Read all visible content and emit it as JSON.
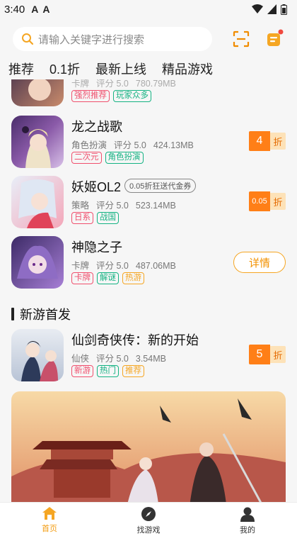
{
  "status_bar": {
    "time": "3:40"
  },
  "search": {
    "placeholder": "请输入关键字进行搜索"
  },
  "tabs": [
    "推荐",
    "0.1折",
    "最新上线",
    "精品游戏"
  ],
  "partial_game": {
    "meta": [
      "卡牌",
      "评分 5.0",
      "780.79MB"
    ],
    "tags": [
      {
        "text": "强烈推荐",
        "color": "red"
      },
      {
        "text": "玩家众多",
        "color": "green"
      }
    ]
  },
  "games": [
    {
      "name": "龙之战歌",
      "category": "角色扮演",
      "rating": "评分 5.0",
      "size": "424.13MB",
      "tags": [
        {
          "text": "二次元",
          "color": "red"
        },
        {
          "text": "角色扮演",
          "color": "green"
        }
      ],
      "discount": "4",
      "discount_unit": "折"
    },
    {
      "name": "妖姬OL2",
      "badge": "0.05折狂送代金券",
      "category": "策略",
      "rating": "评分 5.0",
      "size": "523.14MB",
      "tags": [
        {
          "text": "日系",
          "color": "red"
        },
        {
          "text": "战国",
          "color": "green"
        }
      ],
      "discount": "0.05",
      "discount_unit": "折"
    },
    {
      "name": "神隐之子",
      "category": "卡牌",
      "rating": "评分 5.0",
      "size": "487.06MB",
      "tags": [
        {
          "text": "卡牌",
          "color": "red"
        },
        {
          "text": "解谜",
          "color": "green"
        },
        {
          "text": "热游",
          "color": "orange"
        }
      ],
      "action": "详情"
    }
  ],
  "section": {
    "title": "新游首发"
  },
  "new_game": {
    "name": "仙剑奇侠传：新的开始",
    "category": "仙侠",
    "rating": "评分 5.0",
    "size": "3.54MB",
    "tags": [
      {
        "text": "新游",
        "color": "red"
      },
      {
        "text": "热门",
        "color": "green"
      },
      {
        "text": "推荐",
        "color": "orange"
      }
    ],
    "discount": "5",
    "discount_unit": "折"
  },
  "bottom_nav": [
    {
      "label": "首页",
      "icon": "home-icon",
      "active": true
    },
    {
      "label": "找游戏",
      "icon": "compass-icon",
      "active": false
    },
    {
      "label": "我的",
      "icon": "user-icon",
      "active": false
    }
  ],
  "colors": {
    "accent": "#f39c12",
    "discount": "#ff7f17",
    "tag_red": "#f0506e",
    "tag_green": "#15b383",
    "tag_orange": "#f5a623"
  }
}
